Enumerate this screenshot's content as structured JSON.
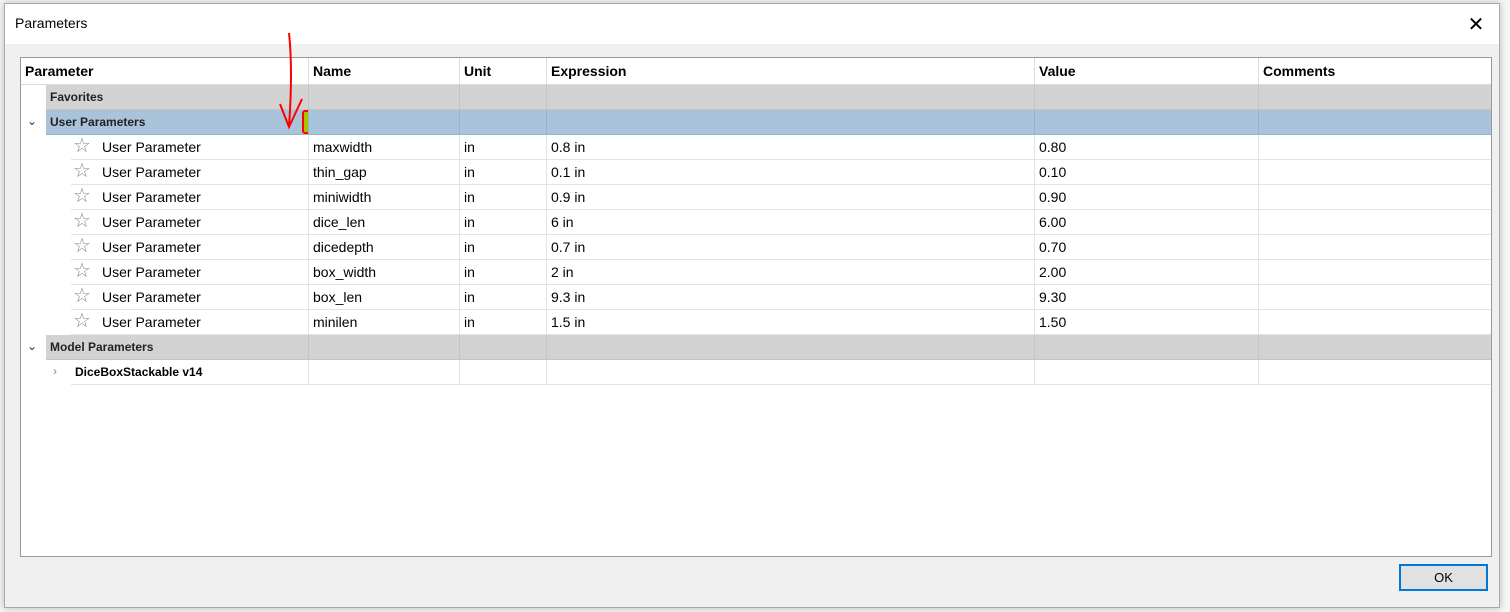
{
  "dialog": {
    "title": "Parameters",
    "ok_label": "OK"
  },
  "columns": [
    "Parameter",
    "Name",
    "Unit",
    "Expression",
    "Value",
    "Comments"
  ],
  "groups": {
    "favorites": "Favorites",
    "user": "User Parameters",
    "model": "Model Parameters",
    "model_child": "DiceBoxStackable v14"
  },
  "rows": [
    {
      "param": "User Parameter",
      "name": "maxwidth",
      "unit": "in",
      "expr": "0.8 in",
      "value": "0.80",
      "comment": ""
    },
    {
      "param": "User Parameter",
      "name": "thin_gap",
      "unit": "in",
      "expr": "0.1 in",
      "value": "0.10",
      "comment": ""
    },
    {
      "param": "User Parameter",
      "name": "miniwidth",
      "unit": "in",
      "expr": "0.9 in",
      "value": "0.90",
      "comment": ""
    },
    {
      "param": "User Parameter",
      "name": "dice_len",
      "unit": "in",
      "expr": "6 in",
      "value": "6.00",
      "comment": ""
    },
    {
      "param": "User Parameter",
      "name": "dicedepth",
      "unit": "in",
      "expr": "0.7 in",
      "value": "0.70",
      "comment": ""
    },
    {
      "param": "User Parameter",
      "name": "box_width",
      "unit": "in",
      "expr": "2 in",
      "value": "2.00",
      "comment": ""
    },
    {
      "param": "User Parameter",
      "name": "box_len",
      "unit": "in",
      "expr": "9.3 in",
      "value": "9.30",
      "comment": ""
    },
    {
      "param": "User Parameter",
      "name": "minilen",
      "unit": "in",
      "expr": "1.5 in",
      "value": "1.50",
      "comment": ""
    }
  ]
}
